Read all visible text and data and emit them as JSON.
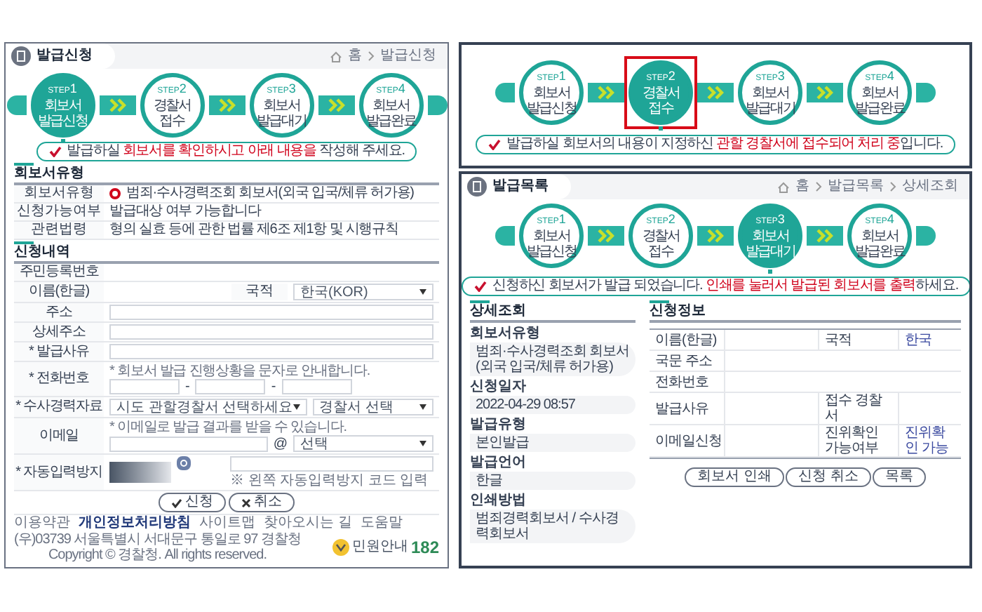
{
  "apply_page": {
    "title": "발급신청",
    "breadcrumb": [
      "홈",
      "발급신청"
    ],
    "steps": [
      {
        "step_label": "STEP",
        "step_number": "1",
        "lines": [
          "회보서",
          "발급신청"
        ],
        "selected": true,
        "highlighted": false
      },
      {
        "step_label": "STEP",
        "step_number": "2",
        "lines": [
          "경찰서",
          "접수"
        ],
        "selected": false,
        "highlighted": false
      },
      {
        "step_label": "STEP",
        "step_number": "3",
        "lines": [
          "회보서",
          "발급대기"
        ],
        "selected": false,
        "highlighted": false
      },
      {
        "step_label": "STEP",
        "step_number": "4",
        "lines": [
          "회보서",
          "발급완료"
        ],
        "selected": false,
        "highlighted": false
      }
    ],
    "notice": "발급하실 **회보서를 확인하시고 아래 내용을** 작성해 주세요.",
    "type_section": {
      "title": "회보서유형",
      "rows": [
        {
          "label": "회보서유형",
          "kind": "radio",
          "value": "범죄·수사경력조회 회보서(외국 입국/체류 허가용)",
          "selected": true
        },
        {
          "label": "신청가능여부",
          "kind": "text",
          "value": "발급대상 여부 가능합니다"
        },
        {
          "label": "관련법령",
          "kind": "text",
          "value": "형의 실효 등에 관한 법률 제6조 제1항 및 시행규칙"
        }
      ]
    },
    "form_section": {
      "title": "신청내역",
      "rows": [
        {
          "label": "주민등록번호",
          "kind": "blank"
        },
        {
          "label": "이름(한글)",
          "kind": "pair",
          "label2": "국적",
          "value2": "한국(KOR)"
        },
        {
          "label": "주소",
          "kind": "input"
        },
        {
          "label": "상세주소",
          "kind": "input"
        },
        {
          "label": "* 발급사유",
          "kind": "input"
        },
        {
          "label": "* 전화번호",
          "kind": "phone",
          "note": "* 회보서 발급 진행상황을 문자로 안내합니다.",
          "separator": "-"
        },
        {
          "label": "* 수사경력자료",
          "kind": "selects",
          "options": [
            "시도 관할경찰서 선택하세요",
            "경찰서 선택"
          ]
        },
        {
          "label": "이메일",
          "kind": "email",
          "note": "* 이메일로 발급 결과를 받을 수 있습니다.",
          "at": "@",
          "value": "선택"
        },
        {
          "label": "* 자동입력방지",
          "kind": "captcha",
          "hint": "※ 왼쪽 자동입력방지 코드 입력"
        }
      ]
    },
    "buttons": [
      {
        "label": "신청",
        "kind": "submit"
      },
      {
        "label": "취소",
        "kind": "cancel"
      }
    ],
    "footer": {
      "links": [
        {
          "label": "이용약관",
          "emphasis": false
        },
        {
          "label": "개인정보처리방침",
          "emphasis": true
        },
        {
          "label": "사이트맵",
          "emphasis": false
        },
        {
          "label": "찾아오시는 길",
          "emphasis": false
        },
        {
          "label": "도움말",
          "emphasis": false
        }
      ],
      "logo_text": "민원안내",
      "logo_number": "182",
      "copyright": [
        "(우)03739 서울특별시 서대문구 통일로 97 경찰청",
        "Copyright © 경찰청. All rights reserved."
      ]
    }
  },
  "step2_page": {
    "steps": [
      {
        "step_label": "STEP",
        "step_number": "1",
        "lines": [
          "회보서",
          "발급신청"
        ],
        "selected": false,
        "highlighted": false
      },
      {
        "step_label": "STEP",
        "step_number": "2",
        "lines": [
          "경찰서",
          "접수"
        ],
        "selected": true,
        "highlighted": true
      },
      {
        "step_label": "STEP",
        "step_number": "3",
        "lines": [
          "회보서",
          "발급대기"
        ],
        "selected": false,
        "highlighted": false
      },
      {
        "step_label": "STEP",
        "step_number": "4",
        "lines": [
          "회보서",
          "발급완료"
        ],
        "selected": false,
        "highlighted": false
      }
    ],
    "notice": "발급하실 회보서의 내용이 지정하신 **관할 경찰서에 접수되어 처리 중**입니다."
  },
  "detail_page": {
    "title": "발급목록",
    "breadcrumb": [
      "홈",
      "발급목록",
      "상세조회"
    ],
    "steps": [
      {
        "step_label": "STEP",
        "step_number": "1",
        "lines": [
          "회보서",
          "발급신청"
        ],
        "selected": false,
        "highlighted": false
      },
      {
        "step_label": "STEP",
        "step_number": "2",
        "lines": [
          "경찰서",
          "접수"
        ],
        "selected": false,
        "highlighted": false
      },
      {
        "step_label": "STEP",
        "step_number": "3",
        "lines": [
          "회보서",
          "발급대기"
        ],
        "selected": true,
        "highlighted": false
      },
      {
        "step_label": "STEP",
        "step_number": "4",
        "lines": [
          "회보서",
          "발급완료"
        ],
        "selected": false,
        "highlighted": false
      }
    ],
    "notice": "신청하신 회보서가 발급 되었습니다. **인쇄를 눌러서 발급된 회보서를 출력**하세요.",
    "summary": {
      "title": "상세조회",
      "items": [
        {
          "label": "회보서유형",
          "value": "범죄·수사경력조회 회보서 (외국 입국/체류 허가용)"
        },
        {
          "label": "신청일자",
          "value": "2022-04-29 08:57"
        },
        {
          "label": "발급유형",
          "value": "본인발급"
        },
        {
          "label": "발급언어",
          "value": "한글"
        },
        {
          "label": "인쇄방법",
          "value": "범죄경력회보서 / 수사경력회보서"
        }
      ]
    },
    "info": {
      "title": "신청정보",
      "rows": [
        {
          "label": "이름(한글)",
          "value": "",
          "label2": "국적",
          "value2": "한국"
        },
        {
          "label": "국문 주소",
          "value": ""
        },
        {
          "label": "전화번호",
          "value": ""
        },
        {
          "label": "발급사유",
          "value": "",
          "label2": "접수 경찰서",
          "value2": ""
        },
        {
          "label": "이메일신청",
          "value": "",
          "label2": "진위확인 가능여부",
          "value2": "진위확인 가능"
        }
      ]
    },
    "buttons": [
      "회보서 인쇄",
      "신청 취소",
      "목록"
    ]
  }
}
